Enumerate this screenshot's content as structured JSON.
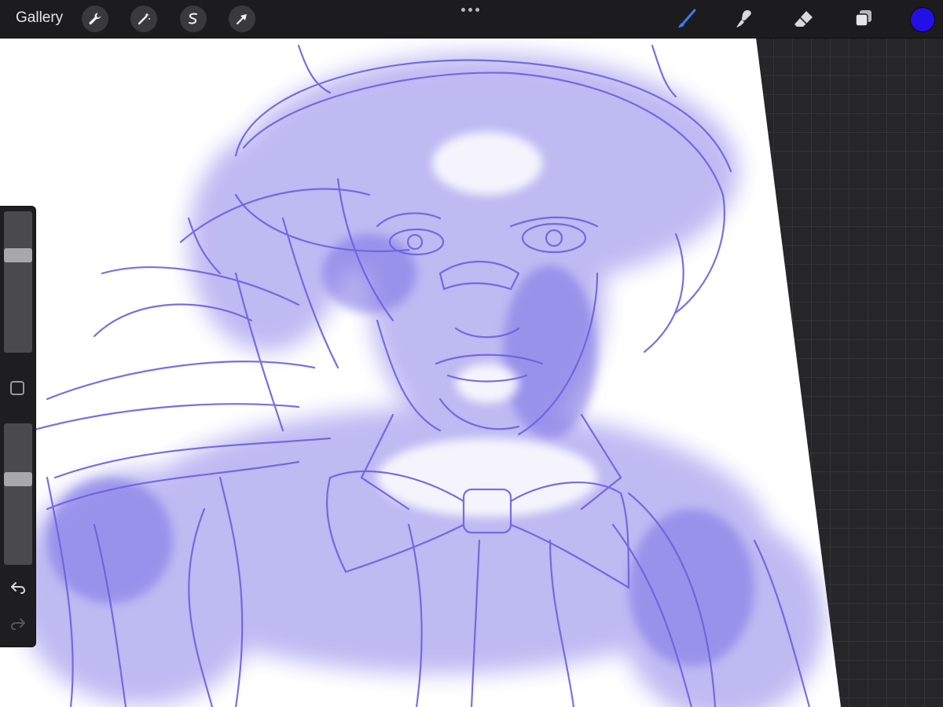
{
  "topbar": {
    "gallery_label": "Gallery",
    "left_tools": [
      {
        "icon": "wrench-icon"
      },
      {
        "icon": "magic-wand-icon"
      },
      {
        "icon": "selection-s-icon"
      },
      {
        "icon": "transform-arrow-icon"
      }
    ],
    "right_tools": [
      {
        "icon": "brush-icon",
        "active": true
      },
      {
        "icon": "smudge-icon",
        "active": false
      },
      {
        "icon": "eraser-icon",
        "active": false
      },
      {
        "icon": "layers-icon",
        "active": false
      }
    ],
    "current_color": "#2410e6",
    "active_tool_color": "#3d7bf5"
  },
  "sidebar": {
    "brush_size_level": 0.71,
    "opacity_level": 0.62
  },
  "artwork": {
    "stroke_color": "#6b60e0",
    "wash_color": "#8a82e8"
  }
}
